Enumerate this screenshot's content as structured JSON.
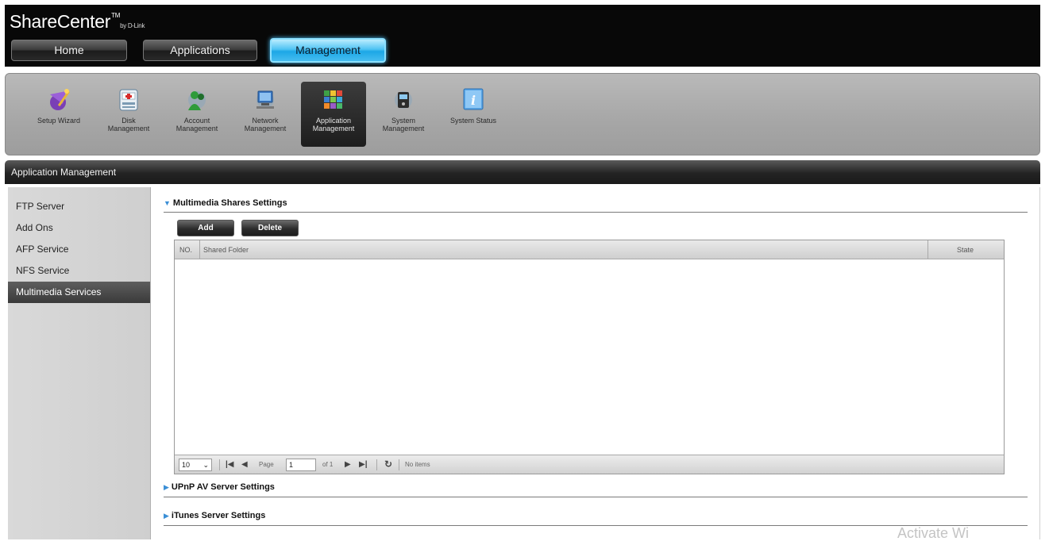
{
  "brand": {
    "name": "ShareCenter",
    "tm": "TM",
    "by": "by D-Link"
  },
  "topnav": [
    {
      "label": "Home"
    },
    {
      "label": "Applications"
    },
    {
      "label": "Management"
    }
  ],
  "toolbar": [
    {
      "label": "Setup Wizard",
      "icon": "wizard-icon"
    },
    {
      "label": "Disk\nManagement",
      "icon": "disk-icon"
    },
    {
      "label": "Account\nManagement",
      "icon": "account-icon"
    },
    {
      "label": "Network\nManagement",
      "icon": "network-icon"
    },
    {
      "label": "Application\nManagement",
      "icon": "application-icon"
    },
    {
      "label": "System\nManagement",
      "icon": "system-icon"
    },
    {
      "label": "System Status",
      "icon": "info-icon"
    }
  ],
  "section_title": "Application Management",
  "sidebar": [
    {
      "label": "FTP Server"
    },
    {
      "label": "Add Ons"
    },
    {
      "label": "AFP Service"
    },
    {
      "label": "NFS Service"
    },
    {
      "label": "Multimedia Services"
    }
  ],
  "multimedia": {
    "title": "Multimedia Shares Settings",
    "add_label": "Add",
    "delete_label": "Delete",
    "columns": {
      "no": "NO.",
      "folder": "Shared Folder",
      "state": "State"
    },
    "pager": {
      "page_size": "10",
      "page_label": "Page",
      "page_value": "1",
      "of_label": "of 1",
      "status": "No items"
    }
  },
  "upnp": {
    "title": "UPnP AV Server Settings"
  },
  "itunes": {
    "title": "iTunes Server Settings"
  },
  "watermark": "Activate Wi",
  "colors": {
    "accent": "#1ca7e6",
    "header": "#080808",
    "active_side": "#4a4a4a"
  }
}
